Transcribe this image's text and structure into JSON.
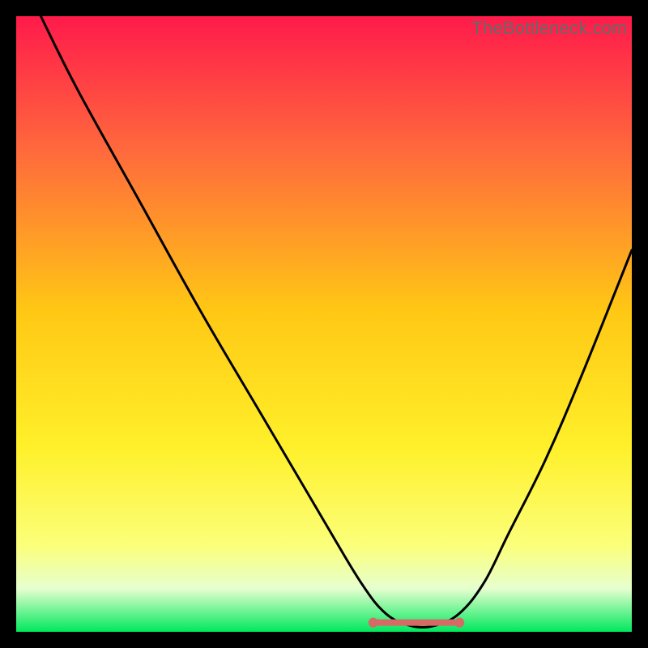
{
  "watermark": "TheBottleneck.com",
  "colors": {
    "background": "#000000",
    "grad_top": "#ff1a4b",
    "grad_mid_upper": "#ff6a3c",
    "grad_mid": "#ffc814",
    "grad_mid_lower": "#fff02a",
    "grad_lower": "#fbff7a",
    "grad_bottom_band": "#e6ffcf",
    "grad_bottom": "#00e85d",
    "curve": "#000000",
    "marker": "#d66a66"
  },
  "chart_data": {
    "type": "line",
    "title": "",
    "xlabel": "",
    "ylabel": "",
    "xlim": [
      0,
      100
    ],
    "ylim": [
      0,
      100
    ],
    "series": [
      {
        "name": "bottleneck-curve",
        "x": [
          4,
          10,
          20,
          30,
          40,
          50,
          56,
          60,
          64,
          68,
          72,
          76,
          80,
          86,
          92,
          100
        ],
        "y": [
          100,
          88,
          70,
          52,
          35,
          18,
          8,
          3,
          1,
          1,
          3,
          8,
          16,
          28,
          42,
          62
        ]
      }
    ],
    "flat_region": {
      "x_start": 58,
      "x_end": 72,
      "y": 1.5
    },
    "markers": [
      {
        "x": 58,
        "y": 1.5
      },
      {
        "x": 72,
        "y": 1.5
      }
    ]
  }
}
